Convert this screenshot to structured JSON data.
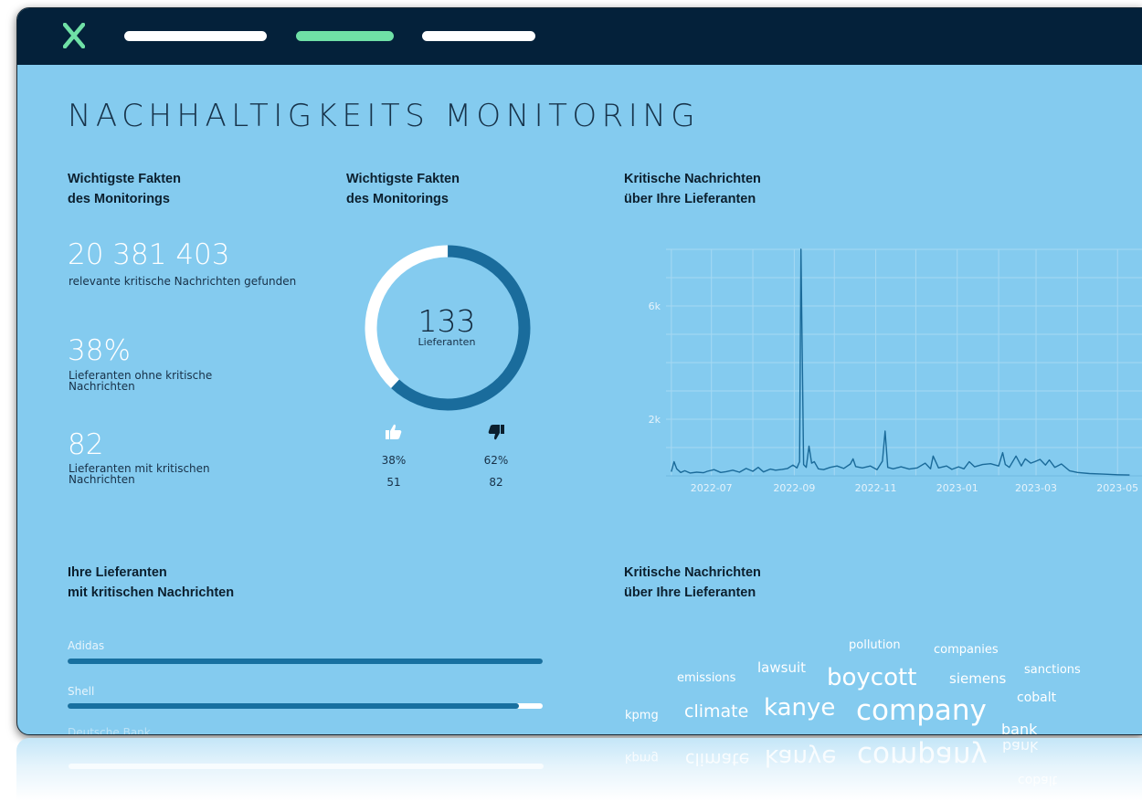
{
  "app": {
    "brand_color": "#6fe0a6",
    "header_color": "#04213a",
    "background_color": "#84cbef",
    "logo_icon": "x-logo-icon"
  },
  "page": {
    "title": "NACHHALTIGKEITS MONITORING"
  },
  "facts": {
    "title_line1": "Wichtigste Fakten",
    "title_line2": "des Monitorings",
    "stats": [
      {
        "value": "20 381 403",
        "label": "relevante kritische Nachrichten gefunden"
      },
      {
        "value": "38%",
        "label": "Lieferanten ohne kritische Nachrichten"
      },
      {
        "value": "82",
        "label": "Lieferanten mit kritischen Nachrichten"
      }
    ]
  },
  "donut": {
    "title_line1": "Wichtigste Fakten",
    "title_line2": "des Monitorings",
    "total": "133",
    "total_label": "Lieferanten",
    "positive_fraction": 0.38,
    "positive_color": "#ffffff",
    "negative_color": "#1a6c9c",
    "positive": {
      "icon": "thumbs-up-icon",
      "percent": "38%",
      "count": "51"
    },
    "negative": {
      "icon": "thumbs-down-icon",
      "percent": "62%",
      "count": "82"
    }
  },
  "news_chart": {
    "title_line1": "Kritische Nachrichten",
    "title_line2": "über Ihre Lieferanten"
  },
  "chart_data": {
    "type": "line",
    "title": "",
    "xlabel": "",
    "ylabel": "",
    "x_ticks": [
      "2022-07",
      "2022-09",
      "2022-11",
      "2023-01",
      "2023-03",
      "2023-05"
    ],
    "y_ticks": [
      "2k",
      "6k"
    ],
    "ylim": [
      0,
      8000
    ],
    "grid": true,
    "line_color": "#1a6a99",
    "series": [
      {
        "x": [
          "2022-06-01",
          "2022-06-03",
          "2022-06-05",
          "2022-06-08",
          "2022-06-11",
          "2022-06-15",
          "2022-06-20",
          "2022-06-25",
          "2022-06-28",
          "2022-07-03",
          "2022-07-08",
          "2022-07-12",
          "2022-07-17",
          "2022-07-22",
          "2022-07-27",
          "2022-08-01",
          "2022-08-05",
          "2022-08-09",
          "2022-08-14",
          "2022-08-18",
          "2022-08-23",
          "2022-08-27",
          "2022-08-31",
          "2022-09-03",
          "2022-09-05",
          "2022-09-06",
          "2022-09-08",
          "2022-09-10",
          "2022-09-12",
          "2022-09-14",
          "2022-09-16",
          "2022-09-19",
          "2022-09-23",
          "2022-09-28",
          "2022-10-03",
          "2022-10-08",
          "2022-10-13",
          "2022-10-15",
          "2022-10-17",
          "2022-10-22",
          "2022-10-28",
          "2022-11-02",
          "2022-11-06",
          "2022-11-08",
          "2022-11-10",
          "2022-11-14",
          "2022-11-20",
          "2022-11-26",
          "2022-12-02",
          "2022-12-08",
          "2022-12-12",
          "2022-12-14",
          "2022-12-18",
          "2022-12-24",
          "2022-12-28",
          "2023-01-02",
          "2023-01-06",
          "2023-01-10",
          "2023-01-14",
          "2023-01-20",
          "2023-01-26",
          "2023-02-01",
          "2023-02-04",
          "2023-02-06",
          "2023-02-09",
          "2023-02-14",
          "2023-02-18",
          "2023-02-21",
          "2023-02-25",
          "2023-02-28",
          "2023-03-04",
          "2023-03-08",
          "2023-03-11",
          "2023-03-15",
          "2023-03-20",
          "2023-03-26",
          "2023-04-01",
          "2023-04-10",
          "2023-04-20",
          "2023-05-01",
          "2023-05-10"
        ],
        "y": [
          150,
          500,
          250,
          120,
          180,
          100,
          130,
          110,
          160,
          220,
          120,
          150,
          200,
          130,
          260,
          160,
          300,
          140,
          240,
          200,
          230,
          260,
          380,
          280,
          500,
          8000,
          400,
          300,
          1050,
          450,
          500,
          250,
          220,
          300,
          350,
          260,
          420,
          600,
          330,
          280,
          350,
          220,
          520,
          1580,
          300,
          250,
          320,
          240,
          280,
          450,
          250,
          700,
          280,
          350,
          230,
          320,
          250,
          500,
          320,
          400,
          430,
          350,
          820,
          400,
          300,
          700,
          350,
          600,
          450,
          500,
          580,
          380,
          560,
          300,
          420,
          180,
          120,
          80,
          60,
          40,
          30
        ]
      }
    ]
  },
  "suppliers": {
    "title_line1": "Ihre Lieferanten",
    "title_line2": "mit kritischen Nachrichten",
    "items": [
      {
        "name": "Adidas",
        "fraction": 1.0
      },
      {
        "name": "Shell",
        "fraction": 0.95
      },
      {
        "name": "Deutsche Bank",
        "fraction": 0.9
      }
    ]
  },
  "word_cloud": {
    "title_line1": "Kritische Nachrichten",
    "title_line2": "über Ihre Lieferanten",
    "words": [
      {
        "text": "pollution"
      },
      {
        "text": "companies"
      },
      {
        "text": "lawsuit"
      },
      {
        "text": "boycott"
      },
      {
        "text": "sanctions"
      },
      {
        "text": "emissions"
      },
      {
        "text": "siemens"
      },
      {
        "text": "cobalt"
      },
      {
        "text": "kpmg"
      },
      {
        "text": "climate"
      },
      {
        "text": "kanye"
      },
      {
        "text": "company"
      },
      {
        "text": "bank"
      }
    ]
  }
}
